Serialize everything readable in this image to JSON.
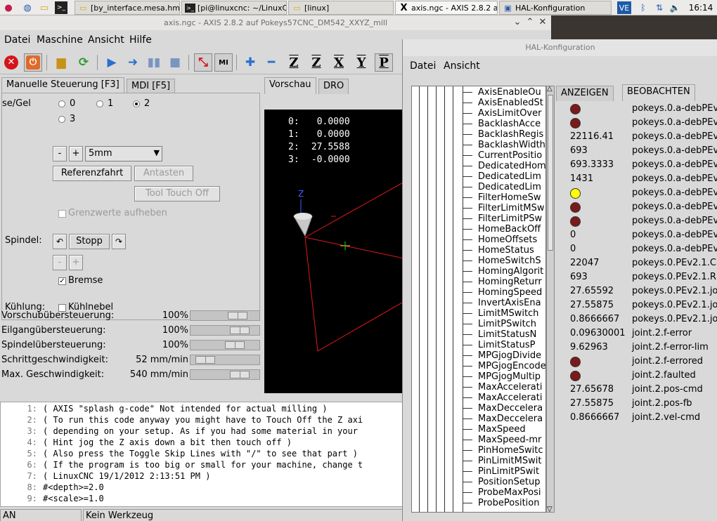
{
  "taskbar": {
    "tasks": [
      {
        "label": "[by_interface.mesa.hm2..."
      },
      {
        "label": "[pi@linuxcnc: ~/LinuxCn..."
      },
      {
        "label": "[linux]"
      },
      {
        "label": "axis.ngc - AXIS 2.8.2 auf..."
      },
      {
        "label": "HAL-Konfiguration"
      }
    ],
    "tray_ve": "VE",
    "clock": "16:14"
  },
  "axis_window": {
    "title": "axis.ngc - AXIS 2.8.2 auf   Pokeys57CNC_DM542_XXYZ_mill",
    "menu": [
      "Datei",
      "Maschine",
      "Ansicht",
      "Hilfe"
    ],
    "toolbar_letters": [
      "Z",
      "Z",
      "X",
      "Y",
      "P"
    ],
    "toolbar_mi": "MI"
  },
  "tabs": {
    "left": [
      "Manuelle Steuerung [F3]",
      "MDI [F5]"
    ],
    "right": [
      "Vorschau",
      "DRO"
    ]
  },
  "manual": {
    "axis_label": "se/Gel",
    "axis_options": [
      "0",
      "1",
      "2",
      "3"
    ],
    "selected_axis": "2",
    "minus": "-",
    "plus": "+",
    "increment": "5mm",
    "referenzfahrt": "Referenzfahrt",
    "antasten": "Antasten",
    "tool_touch_off": "Tool Touch Off",
    "grenzwerte": "Grenzwerte aufheben",
    "spindle_label": "Spindel:",
    "spindle_stop": "Stopp",
    "spindle_minus": "-",
    "spindle_plus": "+",
    "bremse": "Bremse",
    "cooling_label": "Kühlung:",
    "kuehlnebel": "Kühlnebel"
  },
  "sliders": [
    {
      "label": "Vorschubübersteuerung:",
      "value": "100%",
      "level": 0.75
    },
    {
      "label": "Eilgangübersteuerung:",
      "value": "100%",
      "level": 0.8
    },
    {
      "label": "Spindelübersteuerung:",
      "value": "100%",
      "level": 0.7
    },
    {
      "label": "Schrittgeschwindigkeit:",
      "value": "52 mm/min",
      "level": 0.1
    },
    {
      "label": "Max. Geschwindigkeit:",
      "value": "540 mm/min",
      "level": 0.8
    }
  ],
  "dro": [
    {
      "axis": "0:",
      "value": "0.0000"
    },
    {
      "axis": "1:",
      "value": "0.0000"
    },
    {
      "axis": "2:",
      "value": "27.5588"
    },
    {
      "axis": "3:",
      "value": "-0.0000"
    }
  ],
  "preview_axis_label": "Z",
  "gcode": [
    {
      "n": "1:",
      "text": "( AXIS \"splash g-code\" Not intended for actual milling )"
    },
    {
      "n": "2:",
      "text": "( To run this code anyway you might have to Touch Off the Z axi"
    },
    {
      "n": "3:",
      "text": "( depending on your setup. As if you had some material in your"
    },
    {
      "n": "4:",
      "text": "( Hint jog the Z axis down a bit then touch off )"
    },
    {
      "n": "5:",
      "text": "( Also press the Toggle Skip Lines with \"/\" to see that part )"
    },
    {
      "n": "6:",
      "text": "( If the program is too big or small for your machine, change t"
    },
    {
      "n": "7:",
      "text": "( LinuxCNC 19/1/2012 2:13:51 PM )"
    },
    {
      "n": "8:",
      "text": "#<depth>=2.0"
    },
    {
      "n": "9:",
      "text": "#<scale>=1.0"
    }
  ],
  "status": {
    "state": "AN",
    "tool": "Kein Werkzeug"
  },
  "hal": {
    "title": "HAL-Konfiguration",
    "menu": [
      "Datei",
      "Ansicht"
    ],
    "tabs": [
      "ANZEIGEN",
      "BEOBACHTEN"
    ],
    "tree": [
      "AxisEnableOu",
      "AxisEnabledSt",
      "AxisLimitOver",
      "BacklashAcce",
      "BacklashRegis",
      "BacklashWidth",
      "CurrentPositio",
      "DedicatedHom",
      "DedicatedLim",
      "DedicatedLim",
      "FilterHomeSw",
      "FilterLimitMSw",
      "FilterLimitPSw",
      "HomeBackOff",
      "HomeOffsets",
      "HomeStatus",
      "HomeSwitchS",
      "HomingAlgorit",
      "HomingReturr",
      "HomingSpeed",
      "InvertAxisEna",
      "LimitMSwitch",
      "LimitPSwitch",
      "LimitStatusN",
      "LimitStatusP",
      "MPGjogDivide",
      "MPGjogEncode",
      "MPGjogMultip",
      "MaxAccelerati",
      "MaxAccelerati",
      "MaxDeccelera",
      "MaxDeccelera",
      "MaxSpeed",
      "MaxSpeed-mr",
      "PinHomeSwitc",
      "PinLimitMSwit",
      "PinLimitPSwit",
      "PositionSetup",
      "ProbeMaxPosi",
      "ProbePosition"
    ],
    "watch": [
      {
        "led": "dark-red",
        "value": "",
        "name": "pokeys.0.a-debPEv"
      },
      {
        "led": "dark-red",
        "value": "",
        "name": "pokeys.0.a-debPEv"
      },
      {
        "led": "",
        "value": "22116.41",
        "name": "pokeys.0.a-debPEv"
      },
      {
        "led": "",
        "value": "693",
        "name": "pokeys.0.a-debPEv"
      },
      {
        "led": "",
        "value": "693.3333",
        "name": "pokeys.0.a-debPEv"
      },
      {
        "led": "",
        "value": "1431",
        "name": "pokeys.0.a-debPEv"
      },
      {
        "led": "yellow",
        "value": "",
        "name": "pokeys.0.a-debPEv"
      },
      {
        "led": "dark-red",
        "value": "",
        "name": "pokeys.0.a-debPEv"
      },
      {
        "led": "dark-red",
        "value": "",
        "name": "pokeys.0.a-debPEv"
      },
      {
        "led": "",
        "value": "0",
        "name": "pokeys.0.a-debPEv"
      },
      {
        "led": "",
        "value": "0",
        "name": "pokeys.0.a-debPEv"
      },
      {
        "led": "",
        "value": "22047",
        "name": "pokeys.0.PEv2.1.C"
      },
      {
        "led": "",
        "value": "693",
        "name": "pokeys.0.PEv2.1.R"
      },
      {
        "led": "",
        "value": "27.65592",
        "name": "pokeys.0.PEv2.1.jo"
      },
      {
        "led": "",
        "value": "27.55875",
        "name": "pokeys.0.PEv2.1.jo"
      },
      {
        "led": "",
        "value": "0.8666667",
        "name": "pokeys.0.PEv2.1.jo"
      },
      {
        "led": "",
        "value": "0.09630001",
        "name": "joint.2.f-error"
      },
      {
        "led": "",
        "value": "9.62963",
        "name": "joint.2.f-error-lim"
      },
      {
        "led": "dark-red",
        "value": "",
        "name": "joint.2.f-errored"
      },
      {
        "led": "dark-red",
        "value": "",
        "name": "joint.2.faulted"
      },
      {
        "led": "",
        "value": "27.65678",
        "name": "joint.2.pos-cmd"
      },
      {
        "led": "",
        "value": "27.55875",
        "name": "joint.2.pos-fb"
      },
      {
        "led": "",
        "value": "0.8666667",
        "name": "joint.2.vel-cmd"
      }
    ]
  }
}
